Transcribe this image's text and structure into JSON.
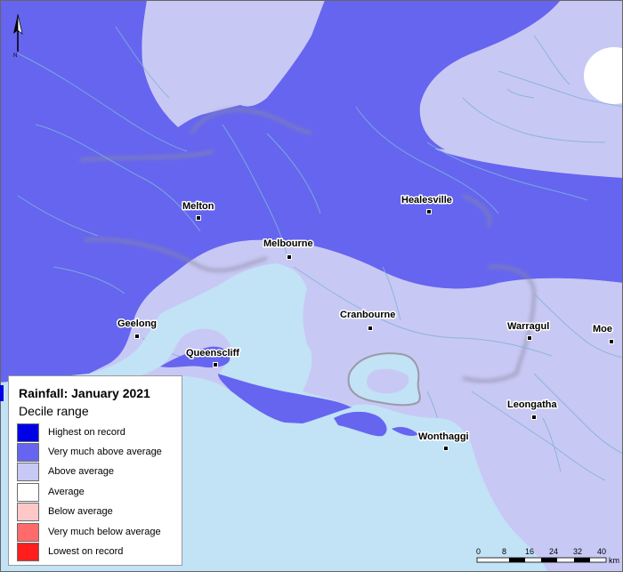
{
  "map": {
    "north_label": "N",
    "colors": {
      "water": "#c2e2f6",
      "very_much_above": "#6565f0",
      "above": "#c8c8f5",
      "average": "#ffffff",
      "river": "#7fb3d6",
      "border": "#8a8a9a"
    },
    "towns": [
      {
        "id": "melton",
        "name": "Melton"
      },
      {
        "id": "healesville",
        "name": "Healesville"
      },
      {
        "id": "melbourne",
        "name": "Melbourne"
      },
      {
        "id": "geelong",
        "name": "Geelong"
      },
      {
        "id": "cranbourne",
        "name": "Cranbourne"
      },
      {
        "id": "warragul",
        "name": "Warragul"
      },
      {
        "id": "moe",
        "name": "Moe"
      },
      {
        "id": "queenscliff",
        "name": "Queenscliff"
      },
      {
        "id": "leongatha",
        "name": "Leongatha"
      },
      {
        "id": "wonthaggi",
        "name": "Wonthaggi"
      }
    ],
    "scale_bar": {
      "ticks": [
        "0",
        "8",
        "16",
        "24",
        "32",
        "40"
      ],
      "unit": "km"
    }
  },
  "legend": {
    "title": "Rainfall: January 2021",
    "subtitle": "Decile range",
    "items": [
      {
        "label": "Highest on record",
        "color": "#0000e6"
      },
      {
        "label": "Very much above average",
        "color": "#6565f0"
      },
      {
        "label": "Above average",
        "color": "#c8c8f5"
      },
      {
        "label": "Average",
        "color": "#ffffff"
      },
      {
        "label": "Below average",
        "color": "#ffc8c8"
      },
      {
        "label": "Very much below average",
        "color": "#ff6a6a"
      },
      {
        "label": "Lowest on record",
        "color": "#ff1e1e"
      }
    ]
  }
}
